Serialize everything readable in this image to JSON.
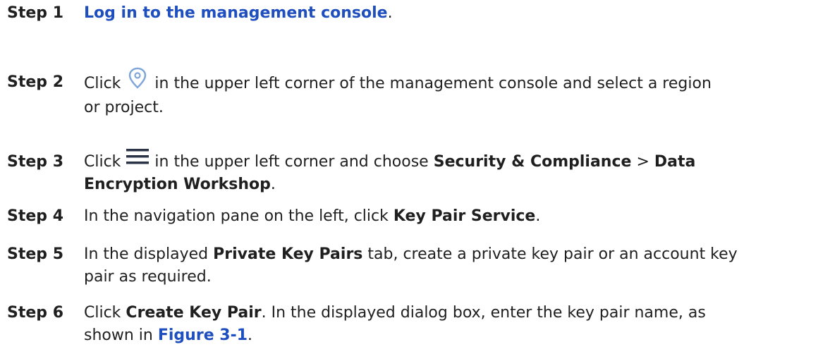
{
  "steps": [
    {
      "label": "Step 1",
      "link": "Log in to the management console",
      "after": "."
    },
    {
      "label": "Step 2",
      "pre": "Click",
      "post": "in the upper left corner of the management console and select a region",
      "cont": "or project.",
      "icon": "location-pin-icon"
    },
    {
      "label": "Step 3",
      "pre": "Click",
      "mid": "in the upper left corner and choose",
      "b1": "Security & Compliance",
      "sep": ">",
      "b2a": "Data",
      "b2b": "Encryption Workshop",
      "end": ".",
      "icon": "hamburger-menu-icon"
    },
    {
      "label": "Step 4",
      "pre": "In the navigation pane on the left, click",
      "b": "Key Pair Service",
      "end": "."
    },
    {
      "label": "Step 5",
      "pre": "In the displayed",
      "b": "Private Key Pairs",
      "post": "tab, create a private key pair or an account key",
      "cont": "pair as required."
    },
    {
      "label": "Step 6",
      "pre": "Click",
      "b": "Create Key Pair",
      "post": ". In the displayed dialog box, enter the key pair name, as",
      "cont": "shown in",
      "link": "Figure 3-1",
      "end": "."
    }
  ],
  "colors": {
    "link": "#1f4fbf",
    "text": "#1f1f1f",
    "pin_icon": "#7fa6d9",
    "menu_icon": "#2a3348"
  }
}
